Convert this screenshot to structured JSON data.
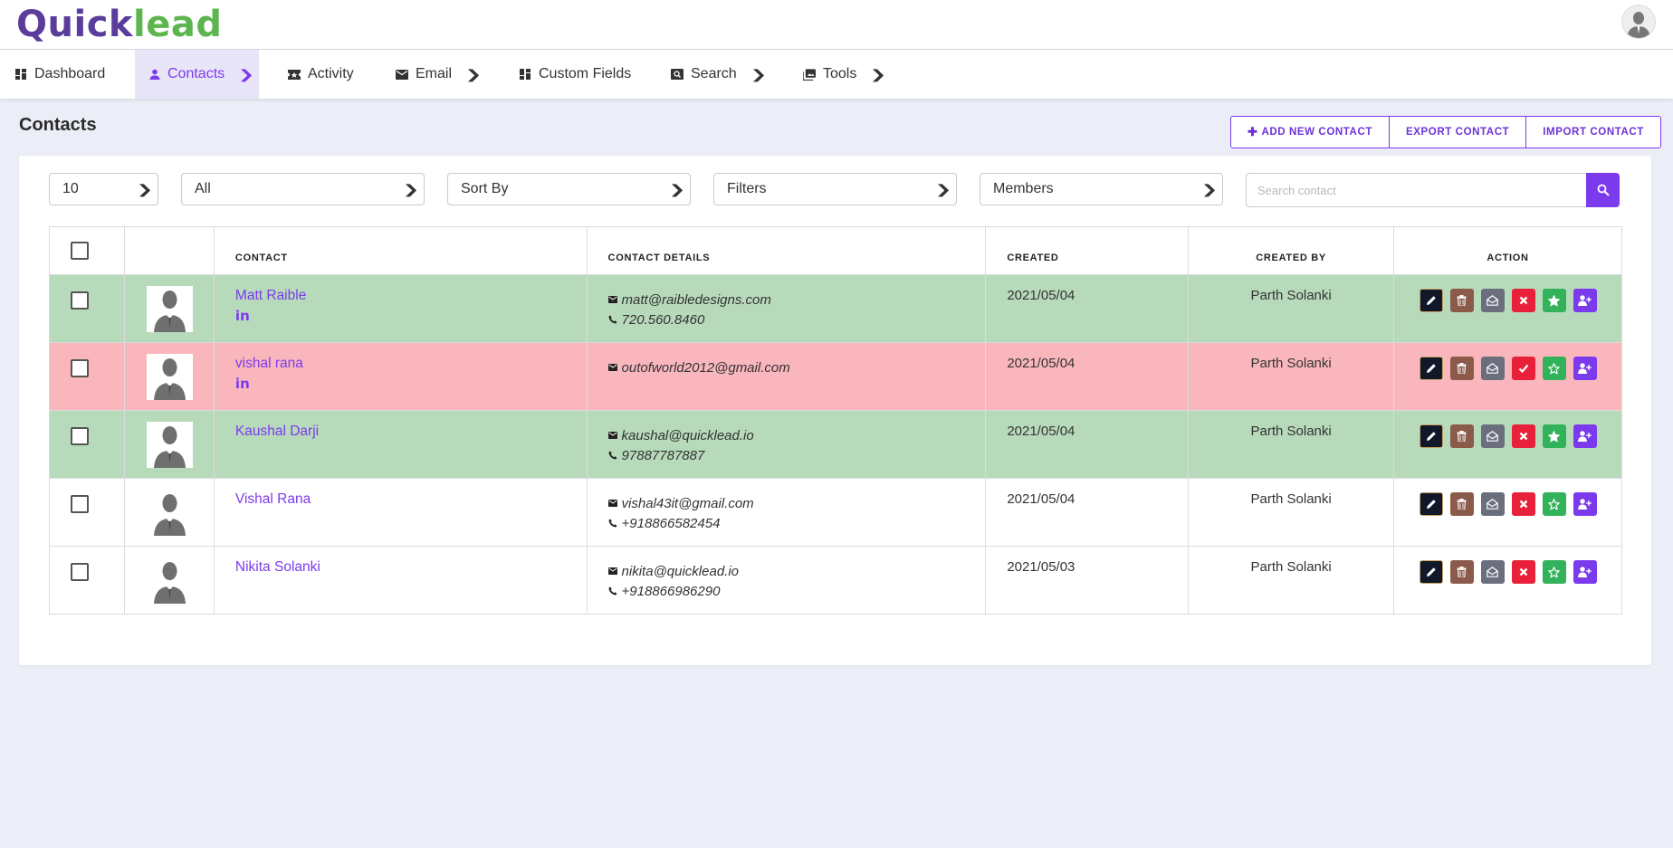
{
  "brand": {
    "part1": "Quick",
    "part2": "lead"
  },
  "nav": {
    "items": [
      {
        "label": "Dashboard",
        "icon": "dashboard-icon",
        "dropdown": false
      },
      {
        "label": "Contacts",
        "icon": "person-icon",
        "dropdown": true,
        "active": true
      },
      {
        "label": "Activity",
        "icon": "ticket-icon",
        "dropdown": false
      },
      {
        "label": "Email",
        "icon": "mail-icon",
        "dropdown": true
      },
      {
        "label": "Custom Fields",
        "icon": "dashboard-icon",
        "dropdown": false
      },
      {
        "label": "Search",
        "icon": "image-search-icon",
        "dropdown": true
      },
      {
        "label": "Tools",
        "icon": "photo-library-icon",
        "dropdown": true
      }
    ]
  },
  "page": {
    "title": "Contacts"
  },
  "actions": {
    "add_new": "ADD NEW CONTACT",
    "export": "EXPORT CONTACT",
    "import": "IMPORT CONTACT"
  },
  "filters": {
    "page_size": "10",
    "scope": "All",
    "sort": "Sort By",
    "filters": "Filters",
    "members": "Members",
    "search_placeholder": "Search contact"
  },
  "table": {
    "headers": {
      "contact": "CONTACT",
      "details": "CONTACT DETAILS",
      "created": "CREATED",
      "created_by": "CREATED BY",
      "action": "ACTION"
    },
    "rows": [
      {
        "name": "Matt Raible",
        "linkedin": "in",
        "email": "matt@raibledesigns.com",
        "phone": "720.560.8460",
        "created": "2021/05/04",
        "created_by": "Parth Solanki",
        "status": "green",
        "flag": "x",
        "star": "solid"
      },
      {
        "name": "vishal rana",
        "linkedin": "in",
        "email": "outofworld2012@gmail.com",
        "phone": "",
        "created": "2021/05/04",
        "created_by": "Parth Solanki",
        "status": "red",
        "flag": "check",
        "star": "outline"
      },
      {
        "name": "Kaushal Darji",
        "linkedin": "",
        "email": "kaushal@quicklead.io",
        "phone": "97887787887",
        "created": "2021/05/04",
        "created_by": "Parth Solanki",
        "status": "green",
        "flag": "x",
        "star": "solid"
      },
      {
        "name": "Vishal Rana",
        "linkedin": "",
        "email": "vishal43it@gmail.com",
        "phone": "+918866582454",
        "created": "2021/05/04",
        "created_by": "Parth Solanki",
        "status": "white",
        "flag": "x",
        "star": "outline"
      },
      {
        "name": "Nikita Solanki",
        "linkedin": "",
        "email": "nikita@quicklead.io",
        "phone": "+918866986290",
        "created": "2021/05/03",
        "created_by": "Parth Solanki",
        "status": "white",
        "flag": "x",
        "star": "outline"
      }
    ]
  },
  "colors": {
    "accent": "#7c3aed",
    "row_green": "#b7dabb",
    "row_red": "#f9b7bd"
  }
}
